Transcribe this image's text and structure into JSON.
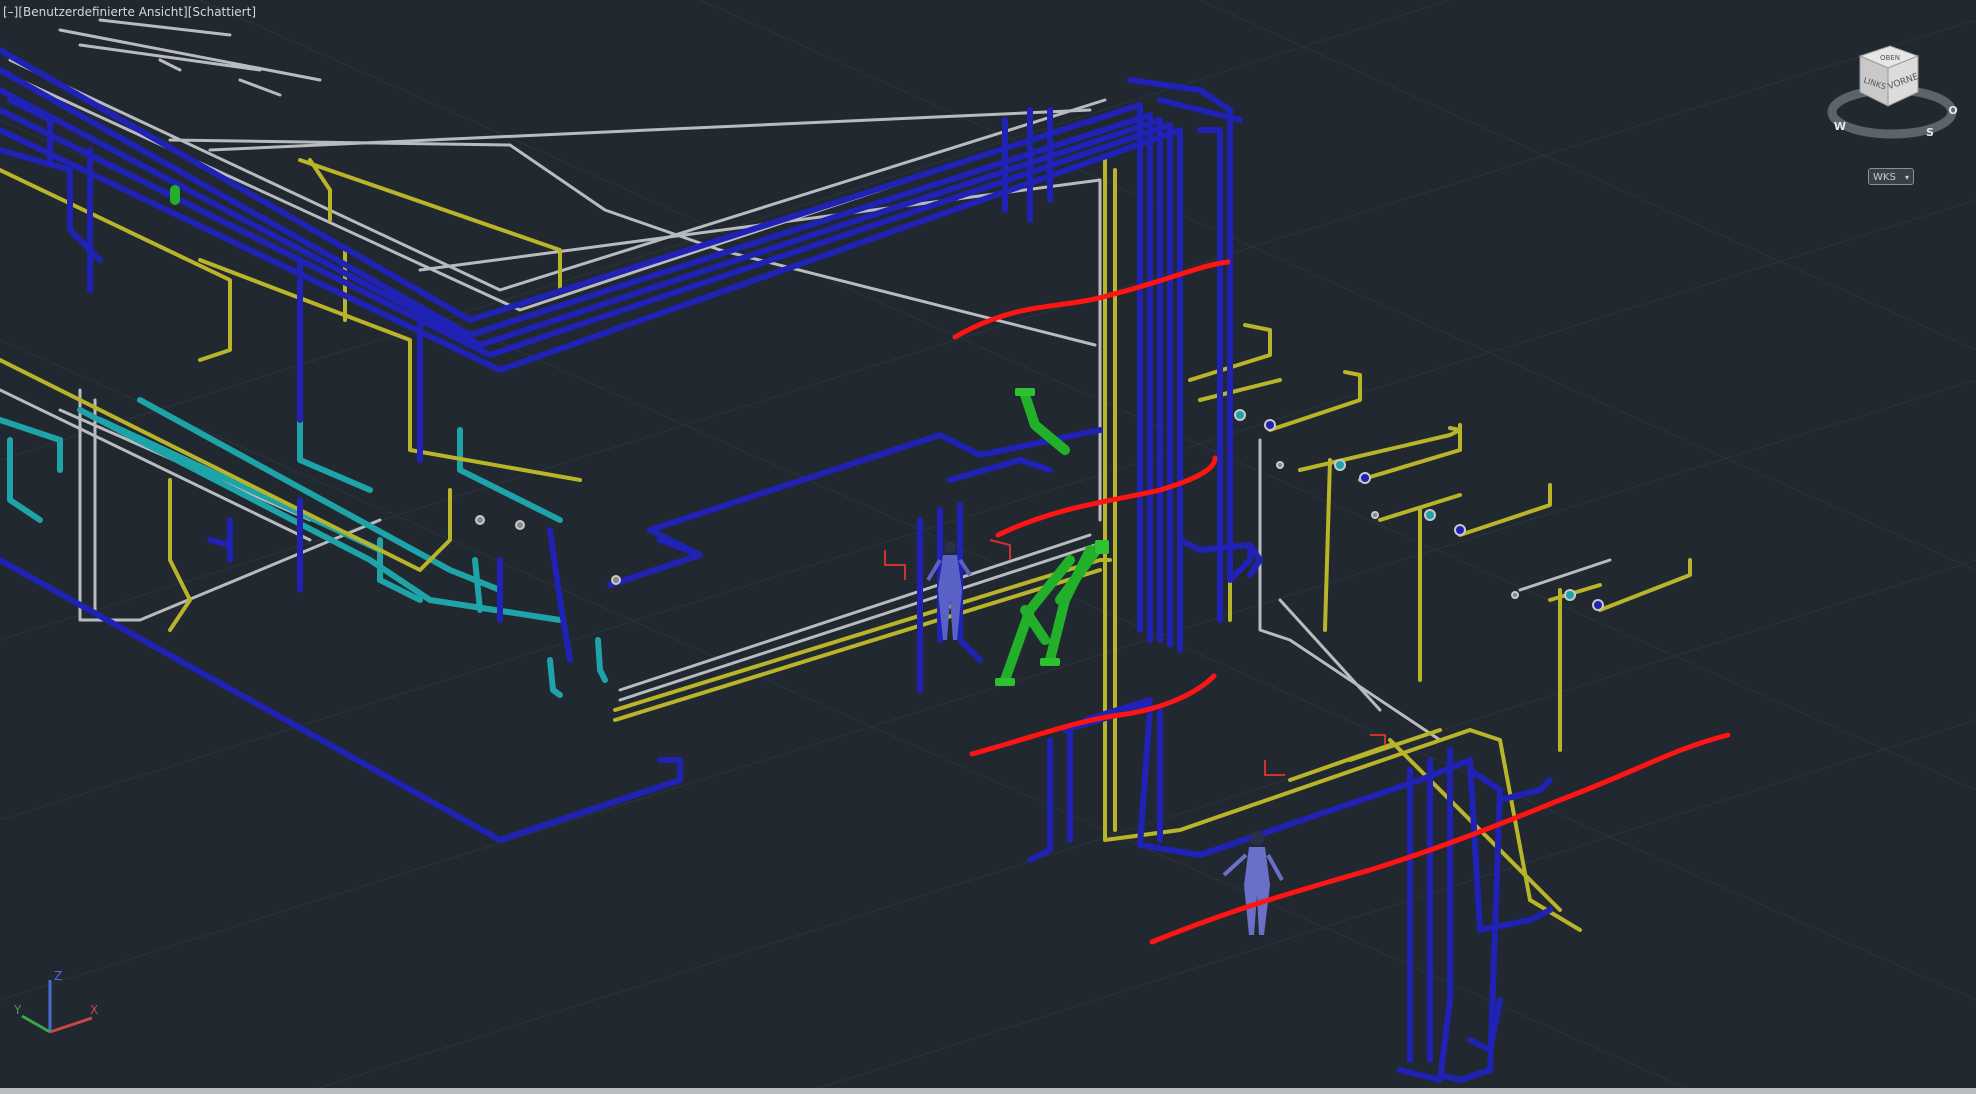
{
  "viewport": {
    "control_label": "[–]",
    "view_label": "[Benutzerdefinierte Ansicht]",
    "style_label": "[Schattiert]"
  },
  "viewcube": {
    "compass_top": "OBEN",
    "face_left": "LINKS",
    "face_right": "VORNE",
    "compass_w": "W",
    "compass_s": "S",
    "compass_o": "O"
  },
  "wcs": {
    "label": "WKS"
  },
  "ucs": {
    "x": "X",
    "y": "Y",
    "z": "Z"
  },
  "colors": {
    "background": "#212830",
    "pipe_blue": "#1f22b4",
    "pipe_yellow": "#b9b42a",
    "pipe_gray": "#b8bcc0",
    "pipe_cyan": "#1ea3a8",
    "pipe_green": "#22b02a",
    "markup_red": "#ff1414"
  }
}
